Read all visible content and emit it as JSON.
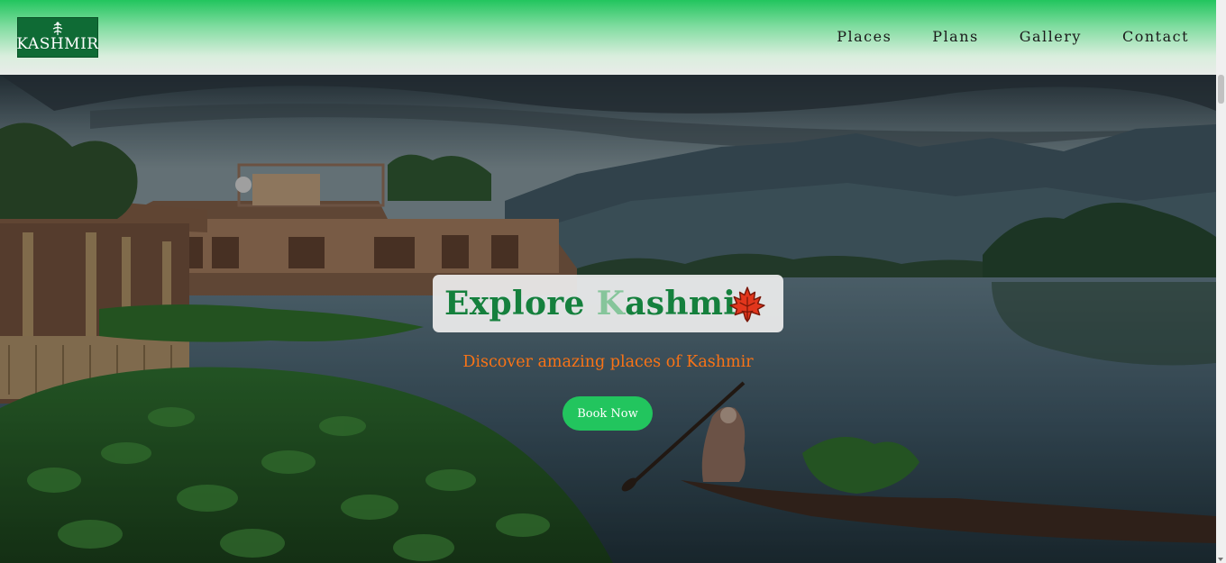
{
  "brand": {
    "logo_text": "KASHMIR",
    "logo_bg": "#0f6b35"
  },
  "nav": {
    "items": [
      {
        "label": "Places"
      },
      {
        "label": "Plans"
      },
      {
        "label": "Gallery"
      },
      {
        "label": "Contact"
      }
    ]
  },
  "hero": {
    "title_solid": "Explore ",
    "title_fade1": "K",
    "title_middle": "ashmi",
    "title_fade2": "r",
    "title_icon": "maple-leaf-icon",
    "subtitle": "Discover amazing places of Kashmir",
    "cta_label": "Book Now"
  },
  "colors": {
    "accent": "#22c55e",
    "title_green": "#15803d",
    "subtitle_orange": "#f97316"
  }
}
